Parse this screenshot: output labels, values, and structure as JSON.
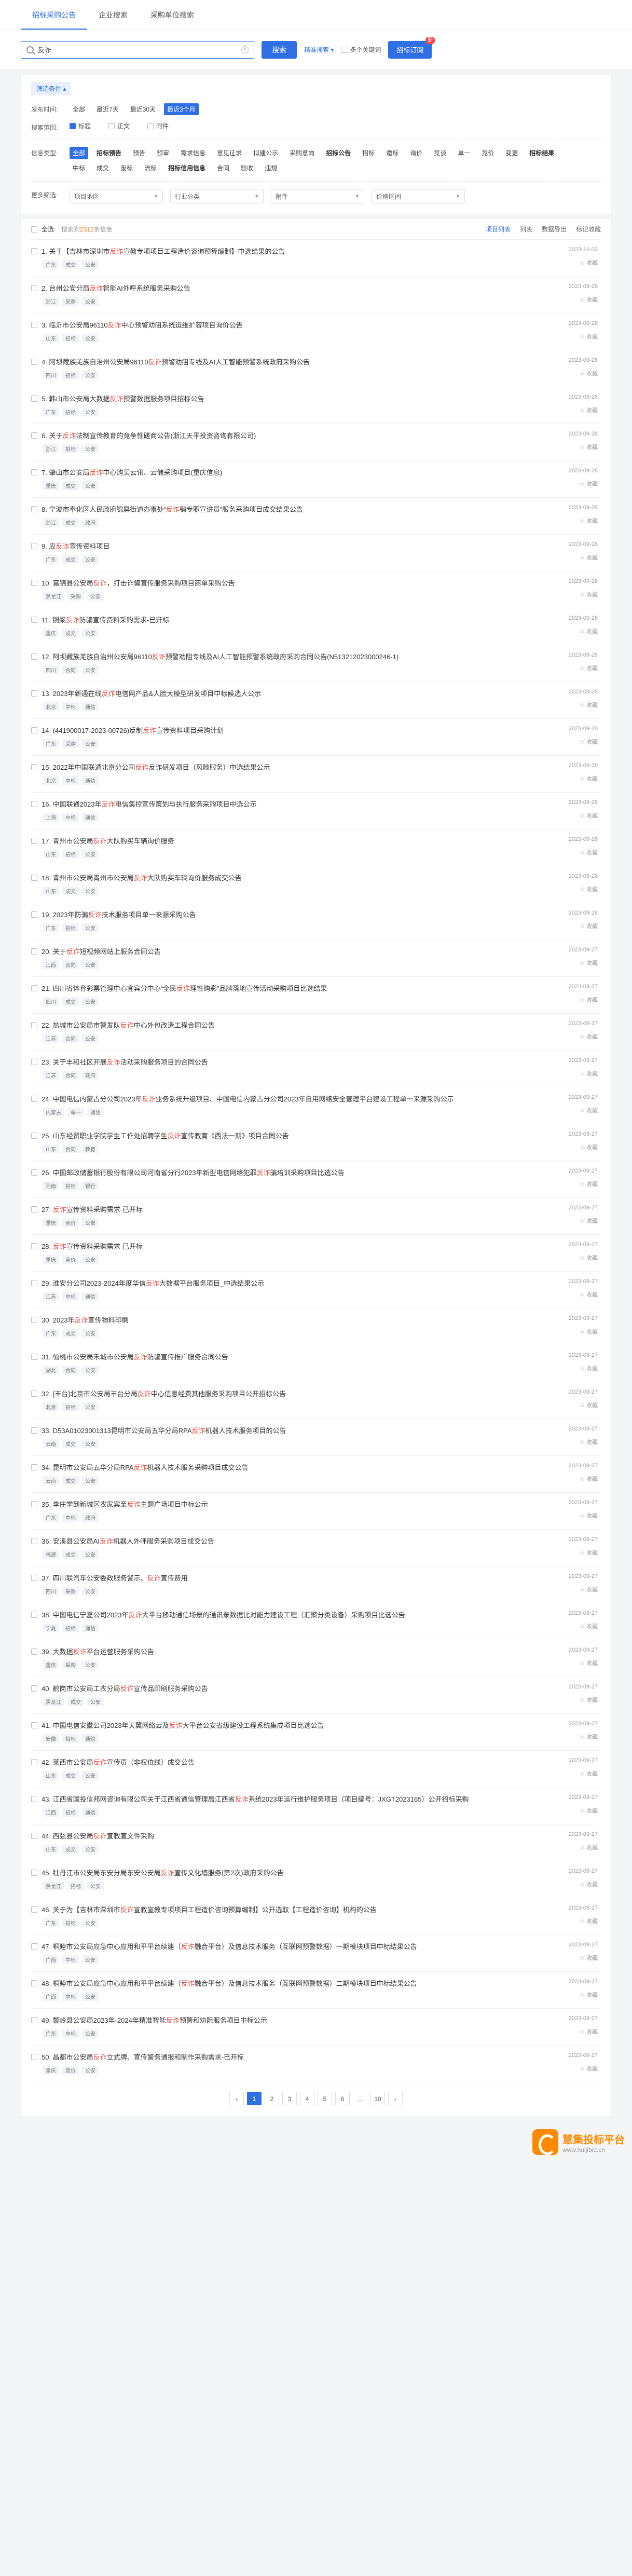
{
  "nav": {
    "tabs": [
      {
        "label": "招标采购公告"
      },
      {
        "label": "企业搜索"
      },
      {
        "label": "采购单位搜索"
      }
    ]
  },
  "search": {
    "value": "反诈",
    "button": "搜索",
    "advanced": "精准搜索 ▾",
    "multi_kw": "多个关键词",
    "subscribe": "招标订阅",
    "subscribe_badge": "新"
  },
  "filters": {
    "title": "筛选条件 ▴",
    "time": {
      "label": "发布时间:",
      "options": [
        "全部",
        "最近7天",
        "最近30天",
        "最近3个月"
      ]
    },
    "scope": {
      "label": "搜索范围:",
      "options": [
        "标题",
        "正文",
        "附件"
      ]
    },
    "type": {
      "label": "信息类型:",
      "row1": [
        "全部",
        "招标预告",
        "预告",
        "预审",
        "需求信息",
        "意见征求",
        "拟建公示",
        "采购意向",
        "招标公告",
        "招标",
        "邀标",
        "询价",
        "竞谈",
        "单一",
        "竞价",
        "变更",
        "招标结果"
      ],
      "row2": [
        "中标",
        "成交",
        "废标",
        "流标",
        "招标信用信息",
        "合同",
        "验收",
        "违规"
      ]
    },
    "more": {
      "label": "更多筛选:",
      "selects": [
        "项目地区",
        "行业分类",
        "附件",
        "价格区间"
      ]
    }
  },
  "list": {
    "all": "全选",
    "found_pre": "搜索到",
    "found_count": "2312",
    "found_post": "条信息",
    "actions": [
      "项目列表",
      "列表",
      "数据导出",
      "标记收藏"
    ],
    "fav_label": "收藏",
    "items": [
      {
        "no": "1.",
        "pre": "关于【吉林市深圳市",
        "hl": "反诈",
        "post": "宣教专项项目工程造价咨询预算编制】中选结果的公告",
        "tags": [
          "广东",
          "成交",
          "公安"
        ],
        "date": "2023-10-02"
      },
      {
        "no": "2.",
        "pre": "台州公安分局",
        "hl": "反诈",
        "post": "智能AI外呼系统服务采购公告",
        "tags": [
          "浙江",
          "采购",
          "公安"
        ],
        "date": "2023-09-28"
      },
      {
        "no": "3.",
        "pre": "临沂市公安局96110",
        "hl": "反诈",
        "post": "中心预警劝阻系统运维扩容项目询价公告",
        "tags": [
          "山东",
          "招标",
          "公安"
        ],
        "date": "2023-09-28"
      },
      {
        "no": "4.",
        "pre": "阿坝藏族羌族自治州公安局96110",
        "hl": "反诈",
        "post": "预警劝阻专线及AI人工智能预警系统政府采购公告",
        "tags": [
          "四川",
          "招标",
          "公安"
        ],
        "date": "2023-09-28"
      },
      {
        "no": "5.",
        "pre": "韩山市公安局大数据",
        "hl": "反诈",
        "post": "预警数据服务项目招标公告",
        "tags": [
          "广东",
          "招标",
          "公安"
        ],
        "date": "2023-09-28"
      },
      {
        "no": "6.",
        "pre": "关于",
        "hl": "反诈",
        "post": "法制宣传教育的竞争性磋商公告(浙江天平投资咨询有限公司)",
        "tags": [
          "浙江",
          "招标",
          "公安"
        ],
        "date": "2023-09-28"
      },
      {
        "no": "7.",
        "pre": "肇山市公安局",
        "hl": "反诈",
        "post": "中心购买云讯、云储采购项目(重庆信息)",
        "tags": [
          "重庆",
          "成交",
          "公安"
        ],
        "date": "2023-09-28"
      },
      {
        "no": "8.",
        "pre": "宁波市奉化区人民政府锦屏街道办事处“",
        "hl": "反诈",
        "post": "骗专职宣讲员”服务采购项目成交结果公告",
        "tags": [
          "浙江",
          "成交",
          "政府"
        ],
        "date": "2023-09-28"
      },
      {
        "no": "9.",
        "pre": "应",
        "hl": "反诈",
        "post": "宣传资料项目",
        "tags": [
          "广东",
          "成交",
          "公安"
        ],
        "date": "2023-09-28"
      },
      {
        "no": "10.",
        "pre": "富锦县公安局",
        "hl": "反诈",
        "post": "，打击诈骗宣传服务采购项目商单采购公告",
        "tags": [
          "黑龙江",
          "采购",
          "公安"
        ],
        "date": "2023-09-28"
      },
      {
        "no": "11.",
        "pre": "铜梁",
        "hl": "反诈",
        "post": "防骗宣传资料采购需求-已开标",
        "tags": [
          "重庆",
          "成交",
          "公安"
        ],
        "date": "2023-09-28"
      },
      {
        "no": "12.",
        "pre": "阿坝藏族羌族自治州公安局96110",
        "hl": "反诈",
        "post": "预警劝阻专线及AI人工智能预警系统政府采购合同公告(N513212023000246-1)",
        "tags": [
          "四川",
          "合同",
          "公安"
        ],
        "date": "2023-09-28"
      },
      {
        "no": "13.",
        "pre": "2023年新通在线",
        "hl": "反诈",
        "post": "电信网产品&",
        "post2": "人脸大模型研发项目中标候选人公示",
        "tags": [
          "北京",
          "中标",
          "通信"
        ],
        "date": "2023-09-28"
      },
      {
        "no": "14.",
        "pre": "(441900017-2023-00726)反制",
        "hl": "反诈",
        "post": "宣传资料项目采购计划",
        "tags": [
          "广东",
          "采购",
          "公安"
        ],
        "date": "2023-09-28"
      },
      {
        "no": "15.",
        "pre": "2022年中国联通北京分公司",
        "hl": "反诈",
        "post": "反诈研发项目（风险服务）中选结果公示",
        "tags": [
          "北京",
          "中标",
          "通信"
        ],
        "date": "2023-09-28"
      },
      {
        "no": "16.",
        "pre": "中国联通2023年",
        "hl": "反诈",
        "post": "电信集控宣传策划与执行服务采购项目中选公示",
        "tags": [
          "上海",
          "中标",
          "通信"
        ],
        "date": "2023-09-28"
      },
      {
        "no": "17.",
        "pre": "青州市公安局",
        "hl": "反诈",
        "post": "大队购买车辆询价服务",
        "tags": [
          "山东",
          "招标",
          "公安"
        ],
        "date": "2023-09-28"
      },
      {
        "no": "18.",
        "pre": "青州市公安局青州市公安局",
        "hl": "反诈",
        "post": "大队购买车辆询价服务成交公告",
        "tags": [
          "山东",
          "成交",
          "公安"
        ],
        "date": "2023-09-28"
      },
      {
        "no": "19.",
        "pre": "2023年防骗",
        "hl": "反诈",
        "post": "技术服务项目单一来源采购公告",
        "tags": [
          "广东",
          "招标",
          "公安"
        ],
        "date": "2023-09-28"
      },
      {
        "no": "20.",
        "pre": "关于",
        "hl": "反诈",
        "post": "短视频网站上服务合同公告",
        "tags": [
          "江西",
          "合同",
          "公安"
        ],
        "date": "2023-09-27"
      },
      {
        "no": "21.",
        "pre": "四川省体育彩票管理中心宜宾分中心“全民",
        "hl": "反诈",
        "post": "理性购彩”品牌落地宣传活动采购项目比选结果",
        "tags": [
          "四川",
          "成交",
          "公安"
        ],
        "date": "2023-09-27"
      },
      {
        "no": "22.",
        "pre": "盐城市公安局市警发队",
        "hl": "反诈",
        "post": "中心外包改造工程合同公告",
        "tags": [
          "江苏",
          "合同",
          "公安"
        ],
        "date": "2023-09-27"
      },
      {
        "no": "23.",
        "pre": "关于丰和社区开展",
        "hl": "反诈",
        "post": "活动采购服务项目的合同公告",
        "tags": [
          "江苏",
          "合同",
          "政府"
        ],
        "date": "2023-09-27"
      },
      {
        "no": "24.",
        "pre": "中国电信内蒙古分公司2023年",
        "hl": "反诈",
        "post": "业务系统升级项目、中国电信内蒙古分公司2023年自用网络安全管理平台建设工程单一来源采购公示",
        "tags": [
          "内蒙古",
          "单一",
          "通信"
        ],
        "date": "2023-09-27"
      },
      {
        "no": "25.",
        "pre": "山东经贸职业学院学生工作处招聘学生",
        "hl": "反诈",
        "post": "宣传教育《西法一期》项目合同公告",
        "tags": [
          "山东",
          "合同",
          "教育"
        ],
        "date": "2023-09-27"
      },
      {
        "no": "26.",
        "pre": "中国邮政储蓄银行股份有限公司河南省分行2023年新型电信网络犯罪",
        "hl": "反诈",
        "post": "骗培训采购项目比选公告",
        "tags": [
          "河南",
          "招标",
          "银行"
        ],
        "date": "2023-09-27"
      },
      {
        "no": "27.",
        "pre": "",
        "hl": "反诈",
        "post": "宣传资料采购需求-已开标",
        "tags": [
          "重庆",
          "竞价",
          "公安"
        ],
        "date": "2023-09-27"
      },
      {
        "no": "28.",
        "pre": "",
        "hl": "反诈",
        "post": "宣传资料采购需求-已开标",
        "tags": [
          "重庆",
          "竞价",
          "公安"
        ],
        "date": "2023-09-27"
      },
      {
        "no": "29.",
        "pre": "淮安分公司2023-2024年度华信",
        "hl": "反诈",
        "post": "大数据平台服务项目_中选结果公示",
        "tags": [
          "江苏",
          "中标",
          "通信"
        ],
        "date": "2023-09-27"
      },
      {
        "no": "30.",
        "pre": "2023年",
        "hl": "反诈",
        "post": "宣传物料印刷",
        "tags": [
          "广东",
          "成交",
          "公安"
        ],
        "date": "2023-09-27"
      },
      {
        "no": "31.",
        "pre": "仙桃市公安局禾城市公安局",
        "hl": "反诈",
        "post": "防骗宣传推广服务合同公告",
        "tags": [
          "湖北",
          "合同",
          "公安"
        ],
        "date": "2023-09-27"
      },
      {
        "no": "32.",
        "pre": "[丰台]北京市公安局丰台分局",
        "hl": "反诈",
        "post": "中心信息经费其他服务采购项目公开招标公告",
        "tags": [
          "北京",
          "招标",
          "公安"
        ],
        "date": "2023-09-27"
      },
      {
        "no": "33.",
        "pre": "D53A01023001313昆明市公安局五华分局RPA",
        "hl": "反诈",
        "post": "机器人技术服务项目的公告",
        "tags": [
          "云南",
          "成交",
          "公安"
        ],
        "date": "2023-09-27"
      },
      {
        "no": "34.",
        "pre": "昆明市公安局五华分局RPA",
        "hl": "反诈",
        "post": "机器人技术服务采购项目成交公告",
        "tags": [
          "云南",
          "成交",
          "公安"
        ],
        "date": "2023-09-27"
      },
      {
        "no": "35.",
        "pre": "李庄学到新城区农家宾至",
        "hl": "反诈",
        "post": "主题广场项目中标公示",
        "tags": [
          "广东",
          "中标",
          "政府"
        ],
        "date": "2023-09-27"
      },
      {
        "no": "36.",
        "pre": "安溪县公安局AI",
        "hl": "反诈",
        "post": "机器人外呼服务采购项目成交公告",
        "tags": [
          "福建",
          "成交",
          "公安"
        ],
        "date": "2023-09-27"
      },
      {
        "no": "37.",
        "pre": "四川联汽车公安委政服务警示、",
        "hl": "反诈",
        "post": "宣传费用",
        "tags": [
          "四川",
          "采购",
          "公安"
        ],
        "date": "2023-09-27"
      },
      {
        "no": "38.",
        "pre": "中国电信宁夏公司2023年",
        "hl": "反诈",
        "post": "大平台移动通信场景的通讯录数据比对能力建设工程（汇聚分类设备）采购项目比选公告",
        "tags": [
          "宁夏",
          "招标",
          "通信"
        ],
        "date": "2023-09-27"
      },
      {
        "no": "39.",
        "pre": "大数据",
        "hl": "反诈",
        "post": "平台运营服务采购公告",
        "tags": [
          "重庆",
          "采购",
          "公安"
        ],
        "date": "2023-09-27"
      },
      {
        "no": "40.",
        "pre": "鹤岗市公安局工农分局",
        "hl": "反诈",
        "post": "宣传品印刷服务采购公告",
        "tags": [
          "黑龙江",
          "成交",
          "公安"
        ],
        "date": "2023-09-27"
      },
      {
        "no": "41.",
        "pre": "中国电信安徽公司2023年天翼网络云及",
        "hl": "反诈",
        "post": "大平台公安省级建设工程系统集成项目比选公告",
        "tags": [
          "安徽",
          "招标",
          "通信"
        ],
        "date": "2023-09-27"
      },
      {
        "no": "42.",
        "pre": "莱西市公安局",
        "hl": "反诈",
        "post": "宣传页（非权位线）成交公告",
        "tags": [
          "山东",
          "成交",
          "公安"
        ],
        "date": "2023-09-27"
      },
      {
        "no": "43.",
        "pre": "江西省国投信邦网咨询有限公司关于江西省通信管理局江西省",
        "hl": "反诈",
        "post": "系统2023年运行维护服务项目（项目编号：JXGT2023165）公开招标采购",
        "tags": [
          "江西",
          "招标",
          "通信"
        ],
        "date": "2023-09-27"
      },
      {
        "no": "44.",
        "pre": "西弦县公安局",
        "hl": "反诈",
        "post": "宣教宣文件采购",
        "tags": [
          "山东",
          "成交",
          "公安"
        ],
        "date": "2023-09-27"
      },
      {
        "no": "45.",
        "pre": "牡丹江市公安局东安分局东安公安局",
        "hl": "反诈",
        "post": "宣传文化墙服务(第2次)政府采购公告",
        "tags": [
          "黑龙江",
          "招标",
          "公安"
        ],
        "date": "2023-09-27"
      },
      {
        "no": "46.",
        "pre": "关于为【吉林市深圳市",
        "hl": "反诈",
        "post": "宣教宣教专项项目工程造价咨询预算编制】公开选取【工程造价咨询】机构的公告",
        "tags": [
          "广东",
          "招标",
          "公安"
        ],
        "date": "2023-09-27"
      },
      {
        "no": "47.",
        "pre": "桐睦市公安局应急中心应用和平平台续建（",
        "hl": "反诈",
        "post": "融合平台）及信息技术服务（互联网预警数据）一期模块项目中标结果公告",
        "tags": [
          "广西",
          "中标",
          "公安"
        ],
        "date": "2023-09-27"
      },
      {
        "no": "48.",
        "pre": "桐睦市公安局应急中心应用和平平台续建（",
        "hl": "反诈",
        "post": "融合平台）及信息技术服务（互联网预警数据）二期模块项目中标结果公告",
        "tags": [
          "广西",
          "中标",
          "公安"
        ],
        "date": "2023-09-27"
      },
      {
        "no": "49.",
        "pre": "黎岭县公安局2023年-2024年精准智能",
        "hl": "反诈",
        "post": "预警和劝阻服务项目中标公示",
        "tags": [
          "广东",
          "中标",
          "公安"
        ],
        "date": "2023-09-27"
      },
      {
        "no": "50.",
        "pre": "昌都市公安局",
        "hl": "反诈",
        "post": "立式牌、宣传警务通报和制作采购需求-已开标",
        "tags": [
          "重庆",
          "竞价",
          "公安"
        ],
        "date": "2023-09-27"
      }
    ]
  },
  "pager": {
    "pages": [
      "‹",
      "1",
      "2",
      "3",
      "4",
      "5",
      "6",
      "…",
      "10",
      "›"
    ]
  },
  "brand": {
    "name": "慧集投标平台",
    "url": "www.huijibid.cn",
    "color": "#ff8a00"
  }
}
